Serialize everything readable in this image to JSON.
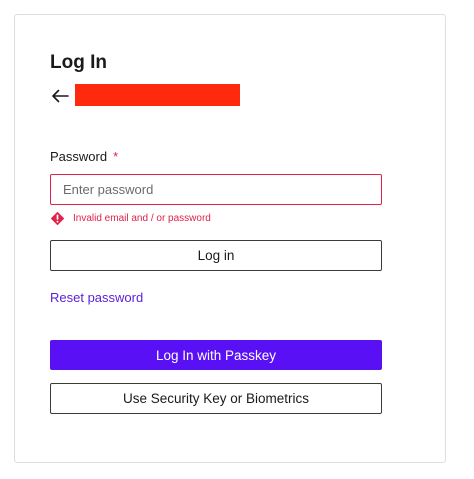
{
  "title": "Log In",
  "back": {
    "icon": "arrow-left-icon"
  },
  "password_field": {
    "label": "Password",
    "required_marker": "*",
    "placeholder": "Enter password",
    "value": ""
  },
  "error": {
    "icon": "warning-diamond-icon",
    "message": "Invalid email and / or password"
  },
  "buttons": {
    "login": "Log in",
    "passkey": "Log In with Passkey",
    "security_key": "Use Security Key or Biometrics"
  },
  "links": {
    "reset_password": "Reset password"
  },
  "colors": {
    "accent": "#5a10f5",
    "link": "#5b1ed8",
    "error": "#e0224a",
    "redaction": "#ff2a0d"
  }
}
